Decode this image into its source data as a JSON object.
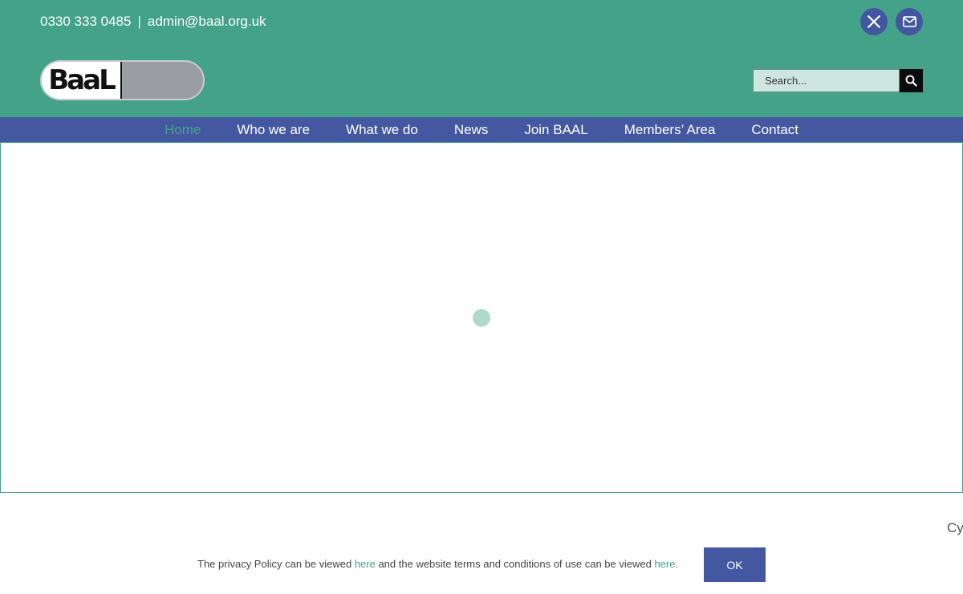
{
  "header": {
    "phone": "0330 333 0485",
    "separator": "|",
    "email": "admin@baal.org.uk",
    "social": [
      {
        "icon": "x-twitter-icon"
      },
      {
        "icon": "envelope-icon"
      }
    ],
    "logo_text": "BaaL"
  },
  "search": {
    "placeholder": "Search...",
    "button_icon": "search-icon"
  },
  "nav": {
    "items": [
      {
        "label": "Home",
        "active": true
      },
      {
        "label": "Who we are"
      },
      {
        "label": "What we do"
      },
      {
        "label": "News"
      },
      {
        "label": "Join BAAL"
      },
      {
        "label": "Members’ Area"
      },
      {
        "label": "Contact"
      }
    ]
  },
  "colors": {
    "header_green": "#43a287",
    "nav_blue": "#4458a1",
    "loader": "#aedacc"
  },
  "edge_text": "Cy",
  "cookie": {
    "text_1": "The privacy Policy can be viewed ",
    "link_1": "here",
    "text_2": " and the website terms and conditions of use can be viewed ",
    "link_2": "here",
    "text_3": ".",
    "ok_label": "OK"
  }
}
